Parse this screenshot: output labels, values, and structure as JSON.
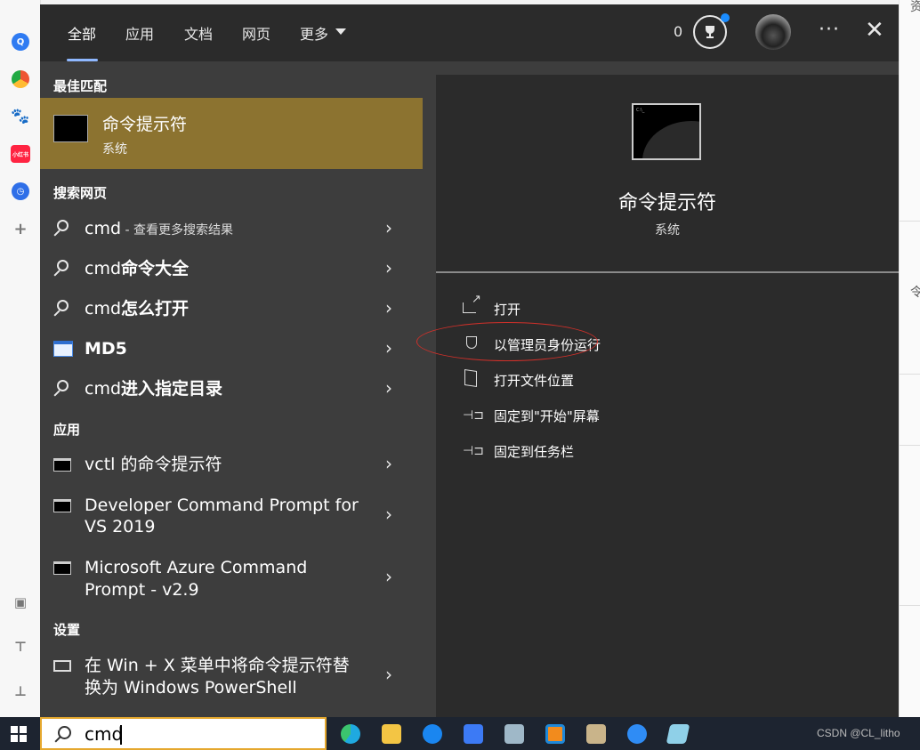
{
  "left_strip": {
    "badge_text": "小红书"
  },
  "right_strip": {
    "chars": [
      "资",
      "令"
    ]
  },
  "tabs": [
    {
      "label": "全部",
      "active": true
    },
    {
      "label": "应用",
      "active": false
    },
    {
      "label": "文档",
      "active": false
    },
    {
      "label": "网页",
      "active": false
    },
    {
      "label": "更多",
      "active": false
    }
  ],
  "header": {
    "reward_count": "0",
    "more_icon": "more-horizontal-icon",
    "close_icon": "close-icon"
  },
  "results": {
    "best_match_heading": "最佳匹配",
    "best_match": {
      "title": "命令提示符",
      "subtitle": "系统"
    },
    "web_heading": "搜索网页",
    "web_items": [
      {
        "prefix": "cmd",
        "suffix": " - 查看更多搜索结果",
        "icon": "search-icon"
      },
      {
        "prefix": "cmd",
        "suffix": "命令大全",
        "icon": "search-icon"
      },
      {
        "prefix": "cmd",
        "suffix": "怎么打开",
        "icon": "search-icon"
      },
      {
        "prefix": "MD5",
        "suffix": "",
        "icon": "md5-app-icon"
      },
      {
        "prefix": "cmd",
        "suffix": "进入指定目录",
        "icon": "search-icon"
      }
    ],
    "apps_heading": "应用",
    "app_items": [
      {
        "line1": "vctl 的命令提示符",
        "line2": ""
      },
      {
        "line1": "Developer Command Prompt for",
        "line2": "VS 2019"
      },
      {
        "line1": "Microsoft Azure Command",
        "line2": "Prompt - v2.9"
      }
    ],
    "settings_heading": "设置",
    "settings_items": [
      {
        "line1": "在 Win + X 菜单中将命令提示符替",
        "line2": "换为 Windows PowerShell"
      }
    ]
  },
  "detail": {
    "icon_caption": "C:\\_",
    "title": "命令提示符",
    "subtitle": "系统",
    "actions": [
      {
        "label": "打开",
        "icon": "open-icon"
      },
      {
        "label": "以管理员身份运行",
        "icon": "shield-icon"
      },
      {
        "label": "打开文件位置",
        "icon": "folder-icon"
      },
      {
        "label": "固定到\"开始\"屏幕",
        "icon": "pin-icon"
      },
      {
        "label": "固定到任务栏",
        "icon": "pin-icon"
      }
    ]
  },
  "taskbar": {
    "search_value": "cmd",
    "watermark": "CSDN @CL_litho",
    "apps": [
      "edge-icon",
      "file-explorer-icon",
      "kugou-icon",
      "feishu-icon",
      "remote-desktop-icon",
      "vmware-icon",
      "game-icon",
      "quark-icon",
      "notes-icon"
    ]
  },
  "colors": {
    "panel_bg": "#3d3d3d",
    "detail_bg": "#2b2b2b",
    "selected_row": "#8c7330",
    "tab_underline": "#8fb8ff",
    "annotation_red": "#d0302a",
    "taskbar_bg": "#1d2430"
  }
}
